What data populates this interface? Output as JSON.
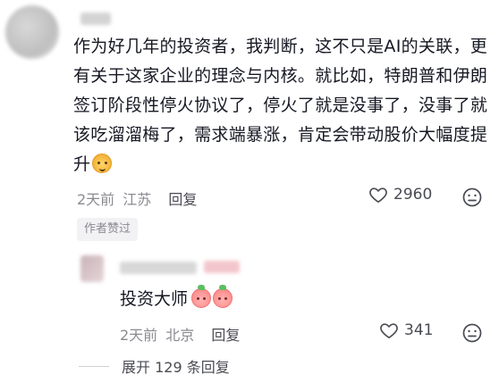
{
  "comment": {
    "text": "作为好几年的投资者，我判断，这不只是AI的关联，更有关于这家企业的理念与内核。就比如，特朗普和伊朗签订阶段性停火协议了，停火了就是没事了，没事了就该吃溜溜梅了，需求端暴涨，肯定会带动股价大幅度提升",
    "time": "2天前",
    "location": "江苏",
    "reply_label": "回复",
    "likes": "2960",
    "author_tag": "作者赞过"
  },
  "reply": {
    "text": "投资大师",
    "time": "2天前",
    "location": "北京",
    "reply_label": "回复",
    "likes": "341"
  },
  "expand": {
    "label": "展开 129 条回复"
  },
  "colors": {
    "text": "#161823",
    "meta": "#8a8b91",
    "tag_bg": "#f2f2f4"
  }
}
